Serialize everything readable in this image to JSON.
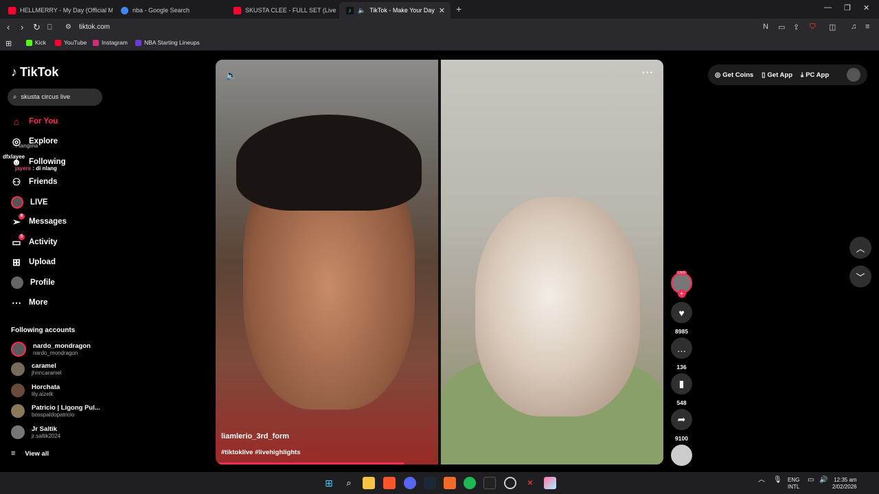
{
  "browser": {
    "tabs": [
      {
        "title": "HELLMERRY - My Day (Official Music",
        "color": "#ff0033"
      },
      {
        "title": "nba - Google Search",
        "color": "#4285f4"
      },
      {
        "title": "SKUSTA CLEE - FULL SET (Live Perfor",
        "color": "#ff0033"
      },
      {
        "title": "TikTok - Make Your Day",
        "color": "#25f4ee",
        "active": true
      }
    ],
    "url": "tiktok.com",
    "bookmarks": [
      {
        "label": "Kick",
        "color": "#53fc18"
      },
      {
        "label": "YouTube",
        "color": "#ff0033"
      },
      {
        "label": "Instagram",
        "color": "#d62976"
      },
      {
        "label": "NBA Starting Lineups",
        "color": "#6a3bd9"
      }
    ]
  },
  "tiktok": {
    "logo": "TikTok",
    "search_value": "skusta circus live",
    "nav": [
      {
        "label": "For You",
        "icon": "home-icon",
        "active": true
      },
      {
        "label": "Explore",
        "icon": "compass-icon"
      },
      {
        "label": "Following",
        "icon": "following-icon"
      },
      {
        "label": "Friends",
        "icon": "friends-icon"
      },
      {
        "label": "LIVE",
        "icon": "live-icon"
      },
      {
        "label": "Messages",
        "icon": "messages-icon",
        "badge": "6"
      },
      {
        "label": "Activity",
        "icon": "activity-icon",
        "badge": "5"
      },
      {
        "label": "Upload",
        "icon": "upload-icon"
      },
      {
        "label": "Profile",
        "icon": "profile-icon"
      },
      {
        "label": "More",
        "icon": "more-icon"
      }
    ],
    "chat_overlay": [
      {
        "user": "",
        "text": "tangina"
      },
      {
        "user": "dfxlayee",
        "text": ""
      },
      {
        "user": "jayers",
        "text": "di nlang"
      }
    ],
    "following_title": "Following accounts",
    "accounts": [
      {
        "name": "nardo_mondragon",
        "handle": "nardo_mondragon"
      },
      {
        "name": "caramel",
        "handle": "jhnncaramel"
      },
      {
        "name": "Horchata",
        "handle": "lily.aizelk"
      },
      {
        "name": "Patricio | Ligong Pul...",
        "handle": "bosspaldopatricio"
      },
      {
        "name": "Jr Saltik",
        "handle": "jr.saltik2024"
      }
    ],
    "view_all": "View all",
    "video": {
      "username": "liamlerio_3rd_form",
      "tags": "#tiktoklive #livehighlights",
      "progress": 0.42
    },
    "actions": {
      "live_label": "LIVE",
      "likes": "8985",
      "comments": "136",
      "saves": "548",
      "shares": "9100"
    },
    "top_right": {
      "coins": "Get Coins",
      "app": "Get App",
      "pc_app": "PC App"
    }
  },
  "taskbar": {
    "lang1": "ENG",
    "lang2": "INTL",
    "time": "12:35 am",
    "date": "2/02/2026"
  }
}
